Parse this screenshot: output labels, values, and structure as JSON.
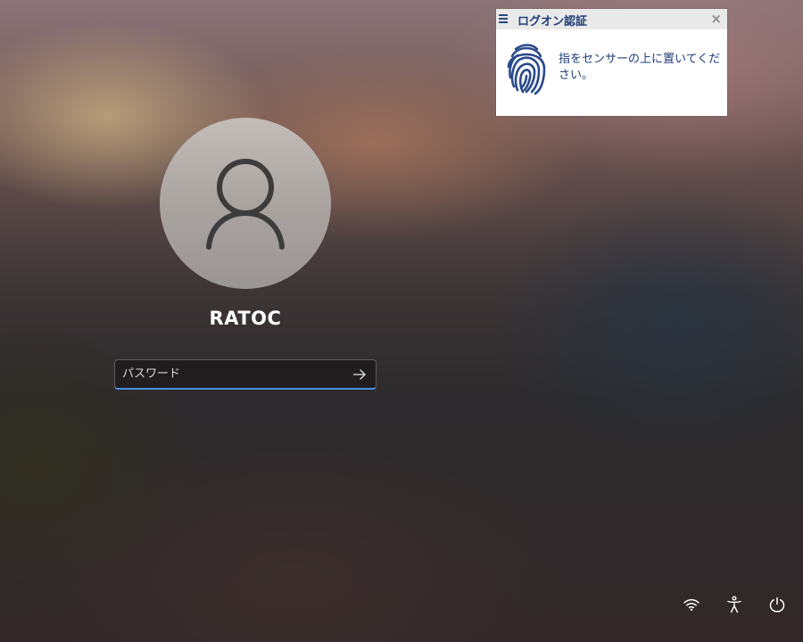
{
  "logon_popup": {
    "title": "ログオン認証",
    "close_label": "×",
    "message": "指をセンサーの上に置いてください。"
  },
  "user": {
    "name": "RATOC"
  },
  "password": {
    "placeholder": "パスワード"
  },
  "icons": {
    "avatar": "person-icon",
    "submit": "arrow-right-icon",
    "menu": "hamburger-menu-icon",
    "fingerprint": "fingerprint-icon",
    "network": "wifi-icon",
    "accessibility": "accessibility-icon",
    "power": "power-icon"
  },
  "colors": {
    "accent": "#4a8fdc",
    "popup_text": "#1f3d78"
  }
}
